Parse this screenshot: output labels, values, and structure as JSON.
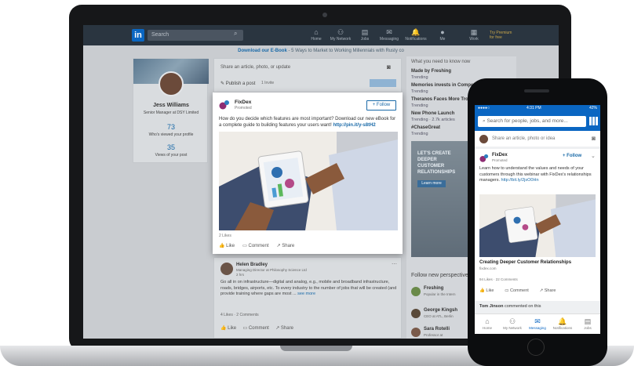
{
  "nav": {
    "logo": "in",
    "search_placeholder": "Search",
    "items": [
      {
        "icon": "home-icon",
        "glyph": "⌂",
        "label": "Home"
      },
      {
        "icon": "network-icon",
        "glyph": "⚇",
        "label": "My Network"
      },
      {
        "icon": "jobs-icon",
        "glyph": "▤",
        "label": "Jobs"
      },
      {
        "icon": "messaging-icon",
        "glyph": "✉",
        "label": "Messaging"
      },
      {
        "icon": "notifications-icon",
        "glyph": "🔔",
        "label": "Notifications"
      },
      {
        "icon": "me-icon",
        "glyph": "●",
        "label": "Me"
      },
      {
        "icon": "work-icon",
        "glyph": "▦",
        "label": "Work"
      }
    ],
    "premium": "Try Premium for free"
  },
  "banner": {
    "link": "Download our E-Book",
    "text": " - 5 Ways to Market to Working Millennials with Rusty co"
  },
  "profile": {
    "name": "Jess Williams",
    "title": "Senior Manager at DSY Limited",
    "views_count": "73",
    "views_label": "Who's viewed your profile",
    "post_views_count": "35",
    "post_views_label": "Views of your post"
  },
  "share_box": {
    "placeholder": "Share an article, photo, or update",
    "publish": "Publish a post",
    "sub": "1 Invite"
  },
  "post": {
    "company": "FixDex",
    "sub": "Promoted",
    "follow": "+ Follow",
    "text": "How do you decide which features are most important? Download our new eBook for a complete guide to building features your users want!",
    "link": "http://pin.it/y-s8tH2",
    "likes": "2 Likes",
    "actions": [
      "Like",
      "Comment",
      "Share"
    ]
  },
  "feed2": {
    "name": "Helen Bradley",
    "title": "Managing Director at Philosophy Science Ltd",
    "time": "2 hrs",
    "text": "Go all in on infrastructure—digital and analog, e.g., mobile and broadband infrastructure, roads, bridges, airports, etc. To every industry to the number of jobs that will be created (and provide training where gaps are most ...",
    "more": "see more",
    "stats": "4 Likes · 2 Comments",
    "actions": [
      "Like",
      "Comment",
      "Share"
    ]
  },
  "right": {
    "heading": "What you need to know now",
    "items": [
      {
        "title": "Made by Freshing",
        "sub": "Trending"
      },
      {
        "title": "Memories invests in Competit",
        "sub": "Trending"
      },
      {
        "title": "Theranos Faces More Trou",
        "sub": "Trending"
      },
      {
        "title": "New Phone Launch",
        "sub": "Trending · 2.7k articles"
      },
      {
        "title": "#ChaseGreat",
        "sub": "Trending"
      }
    ],
    "ad_text": "LET'S CREATE DEEPER CUSTOMER RELATIONSHIPS",
    "ad_btn": "Learn more",
    "follow_heading": "Follow new perspective",
    "people": [
      {
        "name": "Freshing",
        "sub": "Popular in the Intern"
      },
      {
        "name": "George Kingsh",
        "sub": "CEO at ATL, Berlin"
      },
      {
        "name": "Sara Rotelli",
        "sub": "Professor at"
      }
    ]
  },
  "phone": {
    "time": "4:31 PM",
    "battery": "42%",
    "carrier": "●●●●○",
    "search_placeholder": "Search for people, jobs, and more...",
    "share_placeholder": "Share an article, photo or idea",
    "company": "FixDex",
    "sub": "Promoted",
    "follow": "+ Follow",
    "text": "Learn how to understand the values and needs of your customers through this webinar with FixDex's relationships managers.",
    "link": "http://bit.ly/2jsO0Hn",
    "headline": "Creating Deeper Customer Relationships",
    "domain": "fixdex.com",
    "stats": "94 Likes · 22 Comments",
    "actions": [
      "Like",
      "Comment",
      "Share"
    ],
    "next": "Tom Jinson",
    "next_suffix": " commented on this",
    "tabs": [
      {
        "icon": "home-icon",
        "glyph": "⌂",
        "label": "Home"
      },
      {
        "icon": "network-icon",
        "glyph": "⚇",
        "label": "My Network"
      },
      {
        "icon": "messaging-icon",
        "glyph": "✉",
        "label": "Messaging"
      },
      {
        "icon": "notifications-icon",
        "glyph": "🔔",
        "label": "Notifications"
      },
      {
        "icon": "jobs-icon",
        "glyph": "▤",
        "label": "Jobs"
      }
    ]
  }
}
